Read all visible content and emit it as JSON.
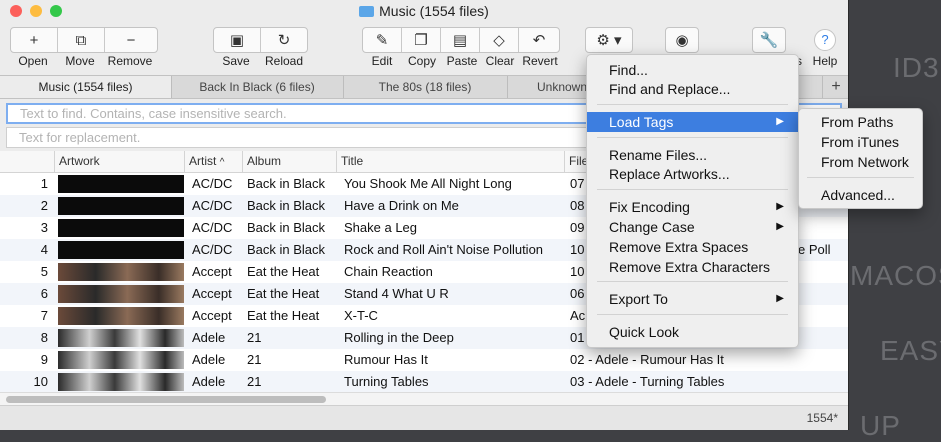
{
  "window": {
    "title": "Music (1554 files)",
    "close_color": "#fc605b",
    "minimize_color": "#fdbc40",
    "zoom_color": "#34c84a"
  },
  "toolbar": {
    "open": "Open",
    "move": "Move",
    "remove": "Remove",
    "save": "Save",
    "reload": "Reload",
    "edit": "Edit",
    "copy": "Copy",
    "paste": "Paste",
    "clear": "Clear",
    "revert": "Revert",
    "tags_partial": "s",
    "help": "Help",
    "icons": {
      "open": "plus-icon",
      "move": "move-icon",
      "remove": "minus-icon",
      "save": "save-icon",
      "reload": "reload-icon",
      "edit": "pencil-icon",
      "copy": "copy-icon",
      "paste": "paste-icon",
      "clear": "eraser-icon",
      "revert": "undo-icon",
      "gear": "gear-icon",
      "eye": "eye-icon",
      "wrench": "wrench-icon",
      "help": "question-icon"
    }
  },
  "tabs": [
    "Music (1554 files)",
    "Back In Black (6 files)",
    "The 80s (18 files)",
    "Unknown"
  ],
  "add_tab_label": "+",
  "search": {
    "placeholder": "Text to find. Contains, case insensitive search."
  },
  "replace": {
    "placeholder": "Text for replacement."
  },
  "table": {
    "headers": {
      "artwork": "Artwork",
      "artist": "Artist",
      "sort_arrow": "^",
      "album": "Album",
      "title": "Title",
      "file": "File"
    },
    "rows": [
      {
        "num": "1",
        "artist": "AC/DC",
        "album": "Back in Black",
        "title": "You Shook Me All Night Long",
        "file": "07"
      },
      {
        "num": "2",
        "artist": "AC/DC",
        "album": "Back in Black",
        "title": "Have a Drink on Me",
        "file": "08"
      },
      {
        "num": "3",
        "artist": "AC/DC",
        "album": "Back in Black",
        "title": "Shake a Leg",
        "file": "09"
      },
      {
        "num": "4",
        "artist": "AC/DC",
        "album": "Back in Black",
        "title": "Rock and Roll Ain't Noise Pollution",
        "file": "10"
      },
      {
        "num": "5",
        "artist": "Accept",
        "album": "Eat the Heat",
        "title": "Chain Reaction",
        "file": "10"
      },
      {
        "num": "6",
        "artist": "Accept",
        "album": "Eat the Heat",
        "title": "Stand 4 What U R",
        "file": "06"
      },
      {
        "num": "7",
        "artist": "Accept",
        "album": "Eat the Heat",
        "title": "X-T-C",
        "file": "Ac"
      },
      {
        "num": "8",
        "artist": "Adele",
        "album": "21",
        "title": "Rolling in the Deep",
        "file": "01"
      },
      {
        "num": "9",
        "artist": "Adele",
        "album": "21",
        "title": "Rumour Has It",
        "file": "02 - Adele - Rumour Has It"
      },
      {
        "num": "10",
        "artist": "Adele",
        "album": "21",
        "title": "Turning Tables",
        "file": "03 - Adele - Turning Tables"
      }
    ],
    "overflow_fragment": "e Poll"
  },
  "status": {
    "count": "1554*"
  },
  "menu": {
    "find": "Find...",
    "find_replace": "Find and Replace...",
    "load_tags": "Load Tags",
    "rename": "Rename Files...",
    "replace_artworks": "Replace Artworks...",
    "fix_encoding": "Fix Encoding",
    "change_case": "Change Case",
    "remove_spaces": "Remove Extra Spaces",
    "remove_chars": "Remove Extra Characters",
    "export_to": "Export To",
    "quick_look": "Quick Look",
    "submenu_arrow": "▶"
  },
  "submenu": {
    "from_paths": "From Paths",
    "from_itunes": "From iTunes",
    "from_network": "From Network",
    "advanced": "Advanced..."
  },
  "background": {
    "t1": "ID3",
    "t2": "MACOS",
    "t3": "EASY",
    "t4": "UP"
  },
  "colors": {
    "highlight": "#3d7ee0",
    "focus_ring": "#7eaef0"
  }
}
